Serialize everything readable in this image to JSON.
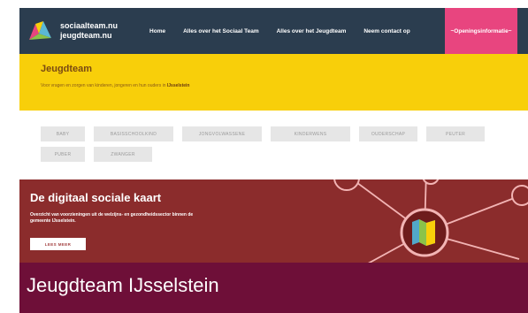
{
  "navbar": {
    "logo_line1": "sociaalteam.nu",
    "logo_line2": "jeugdteam.nu",
    "items": [
      "Home",
      "Alles over het Sociaal Team",
      "Alles over het Jeugdteam",
      "Neem contact op"
    ],
    "cta": "~Openingsinformatie~"
  },
  "hero": {
    "title": "Jeugdteam",
    "subtitle_prefix": "Voor vragen en zorgen van kinderen, jongeren en hun ouders in",
    "subtitle_place": "IJsselstein"
  },
  "tags": [
    "BABY",
    "BASISSCHOOLKIND",
    "JONGVOLWASSENE",
    "KINDERWENS",
    "OUDERSCHAP",
    "PEUTER",
    "PUBER",
    "ZWANGER"
  ],
  "banner": {
    "title": "De digitaal sociale kaart",
    "subtitle": "Overzicht van voorzieningen uit de welzijns- en gezondheidssector binnen de gemeente IJsselstein.",
    "button": "LEES MEER"
  },
  "caption": "Jeugdteam IJsselstein",
  "colors": {
    "navbar_bg": "#2b3d4f",
    "cta_bg": "#e8457f",
    "hero_bg": "#f8cf0a",
    "banner_bg": "#8b2c2c",
    "caption_bg": "#6e0f38"
  }
}
